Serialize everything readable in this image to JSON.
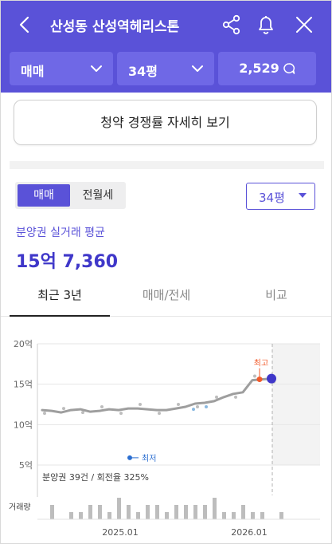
{
  "header": {
    "title": "산성동 산성역헤리스톤",
    "trade_type": "매매",
    "size": "34평",
    "comment_count": "2,529",
    "bg_color": "#5a52d8"
  },
  "icons": [
    "chevron-left-icon",
    "share-icon",
    "bell-icon",
    "close-icon",
    "chevron-down-icon",
    "comment-bubble-icon"
  ],
  "subscription_button": "청약 경쟁률 자세히 보기",
  "segment": {
    "sale": "매매",
    "rent": "전월세",
    "selected": "매매"
  },
  "size_dropdown": "34평",
  "average": {
    "label": "분양권 실거래 평균",
    "value": "15억 7,360"
  },
  "tabs": [
    {
      "label": "최근 3년",
      "active": true
    },
    {
      "label": "매매/전세",
      "active": false
    },
    {
      "label": "비교",
      "active": false
    }
  ],
  "chart_data": {
    "type": "line",
    "y_unit": "억",
    "yticks": [
      "20억",
      "15억",
      "10억",
      "5억"
    ],
    "ylim": [
      5,
      20
    ],
    "xticks": [
      "2025.01",
      "2026.01"
    ],
    "volume_label": "거래량",
    "footnote": "분양권 39건 / 회전율 325%",
    "annotations": {
      "max_label": "최고",
      "min_label": "최저"
    },
    "colors": {
      "line": "#9e9e9e",
      "max": "#f25a2a",
      "current": "#3f37c9",
      "min": "#2c6fd1",
      "scatter": "#bdbdbd"
    },
    "series": [
      {
        "x": [
          "2024.03",
          "2024.04",
          "2024.05",
          "2024.06",
          "2024.07",
          "2024.08",
          "2024.09",
          "2024.10",
          "2024.11",
          "2024.12",
          "2025.01",
          "2025.02",
          "2025.03",
          "2025.04",
          "2025.05",
          "2025.06",
          "2025.07",
          "2025.08",
          "2025.09",
          "2025.10",
          "2025.11",
          "2025.12",
          "2026.01",
          "2026.02",
          "2026.03"
        ],
        "y": [
          11.8,
          11.7,
          11.5,
          11.8,
          11.9,
          11.6,
          11.7,
          11.9,
          11.8,
          12.0,
          12.0,
          11.9,
          11.8,
          11.8,
          12.0,
          12.2,
          12.6,
          12.7,
          12.9,
          13.4,
          13.8,
          14.0,
          15.5,
          15.6,
          15.7
        ]
      }
    ],
    "volume": [
      2,
      0,
      1,
      1,
      2,
      2,
      1,
      3,
      2,
      1,
      2,
      2,
      1,
      2,
      2,
      2,
      2,
      3,
      1,
      1,
      2,
      1,
      1,
      0,
      1
    ]
  }
}
